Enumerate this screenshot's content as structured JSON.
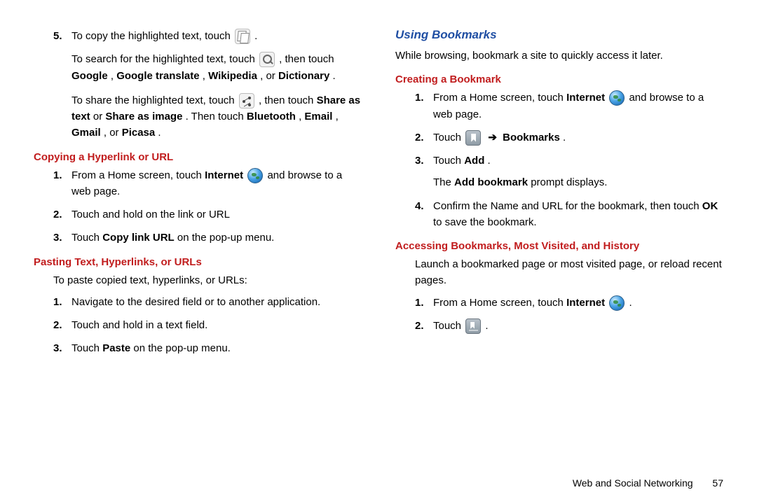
{
  "left": {
    "step5": {
      "num": "5.",
      "p1a": "To copy the highlighted text, touch ",
      "p1b": " .",
      "p2a": "To search for the highlighted text, touch ",
      "p2b": " , then touch ",
      "p2c": "Google",
      "p2d": ", ",
      "p2e": "Google translate",
      "p2f": ", ",
      "p2g": "Wikipedia",
      "p2h": ", or ",
      "p2i": "Dictionary",
      "p2j": ".",
      "p3a": "To share the highlighted text, touch ",
      "p3b": " , then touch ",
      "p3c": "Share as text",
      "p3d": " or ",
      "p3e": "Share as image",
      "p3f": ". Then touch ",
      "p3g": "Bluetooth",
      "p3h": ", ",
      "p3i": "Email",
      "p3j": ", ",
      "p3k": "Gmail",
      "p3l": ", or ",
      "p3m": "Picasa",
      "p3n": "."
    },
    "h_copy": "Copying a Hyperlink or URL",
    "copy": {
      "n1": "1.",
      "s1a": "From a Home screen, touch ",
      "s1b": "Internet",
      "s1c": " and browse to a web page.",
      "n2": "2.",
      "s2": "Touch and hold on the link or URL",
      "n3": "3.",
      "s3a": "Touch ",
      "s3b": "Copy link URL",
      "s3c": " on the pop-up menu."
    },
    "h_paste": "Pasting Text, Hyperlinks, or URLs",
    "paste_intro": "To paste copied text, hyperlinks, or URLs:",
    "paste": {
      "n1": "1.",
      "s1": "Navigate to the desired field or to another application.",
      "n2": "2.",
      "s2": "Touch and hold in a text field.",
      "n3": "3.",
      "s3a": "Touch ",
      "s3b": "Paste",
      "s3c": " on the pop-up menu."
    }
  },
  "right": {
    "h_using": "Using Bookmarks",
    "intro": "While browsing, bookmark a site to quickly access it later.",
    "h_create": "Creating a Bookmark",
    "create": {
      "n1": "1.",
      "s1a": "From a Home screen, touch ",
      "s1b": "Internet",
      "s1c": " and browse to a web page.",
      "n2": "2.",
      "s2a": "Touch ",
      "s2b": "Bookmarks",
      "s2c": ".",
      "n3": "3.",
      "s3a": "Touch ",
      "s3b": "Add",
      "s3c": ".",
      "s3da": "The ",
      "s3db": "Add bookmark",
      "s3dc": " prompt displays.",
      "n4": "4.",
      "s4a": "Confirm the Name and URL for the bookmark, then touch ",
      "s4b": "OK",
      "s4c": " to save the bookmark."
    },
    "h_access": "Accessing Bookmarks, Most Visited, and History",
    "access_intro": "Launch a bookmarked page or most visited page, or reload recent pages.",
    "access": {
      "n1": "1.",
      "s1a": "From a Home screen, touch ",
      "s1b": "Internet",
      "s1c": " .",
      "n2": "2.",
      "s2a": "Touch ",
      "s2b": " ."
    }
  },
  "arrow": "➔",
  "footer": {
    "section": "Web and Social Networking",
    "page": "57"
  }
}
